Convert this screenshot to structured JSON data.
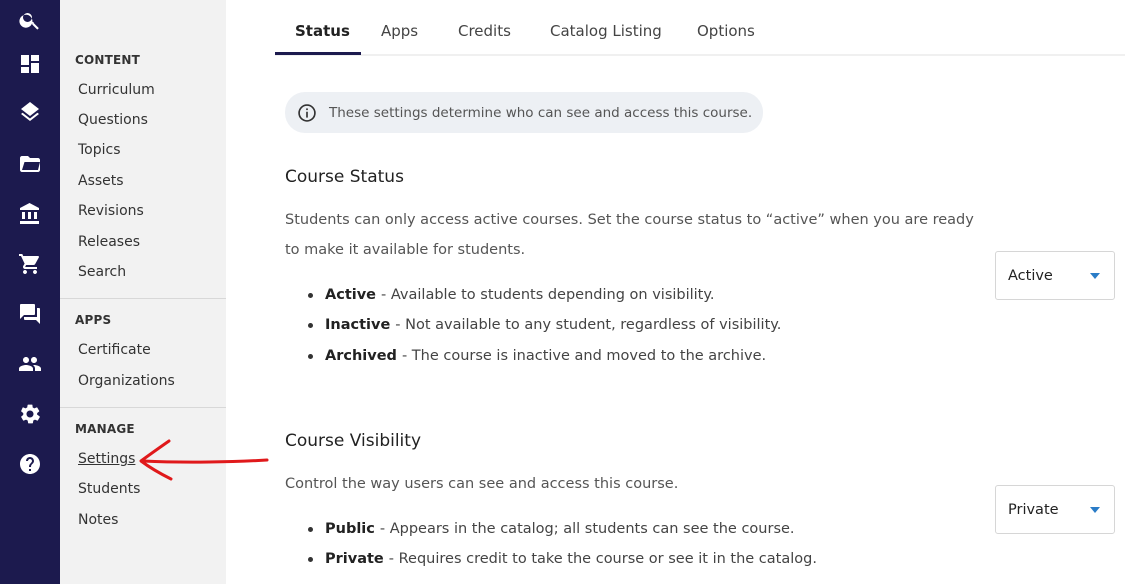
{
  "rail": {
    "icons": [
      "search-icon",
      "dashboard-icon",
      "layers-icon",
      "folder-icon",
      "institution-icon",
      "cart-icon",
      "chat-icon",
      "people-icon",
      "gear-icon",
      "help-icon"
    ]
  },
  "subnav": {
    "content_title": "CONTENT",
    "content_items": [
      "Curriculum",
      "Questions",
      "Topics",
      "Assets",
      "Revisions",
      "Releases",
      "Search"
    ],
    "apps_title": "APPS",
    "apps_items": [
      "Certificate",
      "Organizations"
    ],
    "manage_title": "MANAGE",
    "manage_items": [
      "Settings",
      "Students",
      "Notes"
    ]
  },
  "tabs": [
    "Status",
    "Apps",
    "Credits",
    "Catalog Listing",
    "Options"
  ],
  "info": "These settings determine who can see and access this course.",
  "status": {
    "title": "Course Status",
    "desc": "Students can only access active courses. Set the course status to “active” when you are ready to make it available for students.",
    "bullets": [
      {
        "term": "Active",
        "desc": "- Available to students depending on visibility."
      },
      {
        "term": "Inactive",
        "desc": "- Not available to any student, regardless of visibility."
      },
      {
        "term": "Archived",
        "desc": "- The course is inactive and moved to the archive."
      }
    ],
    "selected": "Active"
  },
  "visibility": {
    "title": "Course Visibility",
    "desc": "Control the way users can see and access this course.",
    "bullets": [
      {
        "term": "Public",
        "desc": "- Appears in the catalog; all students can see the course."
      },
      {
        "term": "Private",
        "desc": "- Requires credit to take the course or see it in the catalog."
      }
    ],
    "selected": "Private"
  },
  "colors": {
    "rail_bg": "#1c1a4e",
    "subnav_bg": "#f2f2f2",
    "caret": "#2a7cc7",
    "annotation_arrow": "#e0191b"
  }
}
